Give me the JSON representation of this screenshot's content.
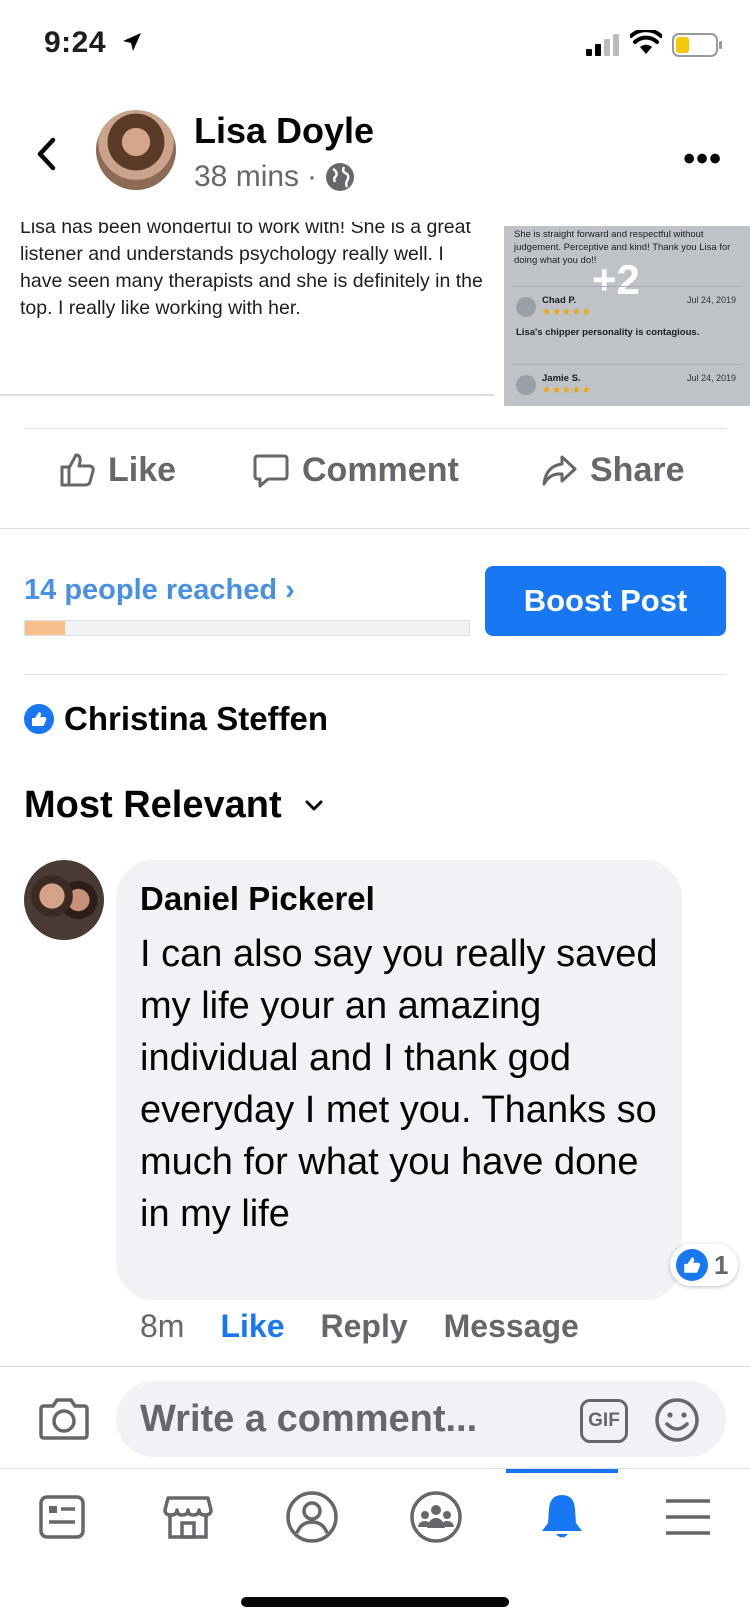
{
  "status_bar": {
    "time": "9:24"
  },
  "post": {
    "author": "Lisa Doyle",
    "time": "38 mins",
    "separator": "·",
    "text": "Lisa has been wonderful to work with! She is a great listener and understands psychology really well. I have seen many therapists and she is definitely in the top. I really like working with her.",
    "review_image": {
      "top_text": "She is straight forward and respectful without judgement.  Perceptive and kind! Thank you Lisa for doing what you do!!",
      "more_count": "+2",
      "entries": [
        {
          "name": "Chad P.",
          "date": "Jul 24, 2019",
          "stars": "★★★★★",
          "text": "Lisa's chipper personality is contagious."
        },
        {
          "name": "Jamie S.",
          "date": "Jul 24, 2019",
          "stars": "★★★★★",
          "text": ""
        }
      ]
    }
  },
  "actions": {
    "like": "Like",
    "comment": "Comment",
    "share": "Share"
  },
  "reach": {
    "label": "14 people reached",
    "chevron": "›",
    "progress_percent": 9,
    "boost_label": "Boost Post"
  },
  "liker": {
    "name": "Christina Steffen"
  },
  "sort": {
    "label": "Most Relevant"
  },
  "comment": {
    "author": "Daniel Pickerel",
    "text": "I can also say you really saved my life your an amazing individual and I thank god everyday I met you. Thanks so much for what you have done in my life",
    "reaction_count": "1",
    "time": "8m",
    "like": "Like",
    "reply": "Reply",
    "message": "Message"
  },
  "composer": {
    "placeholder": "Write a comment...",
    "gif": "GIF"
  },
  "tabs": [
    {
      "name": "news-feed-icon"
    },
    {
      "name": "marketplace-icon"
    },
    {
      "name": "profile-icon"
    },
    {
      "name": "groups-icon"
    },
    {
      "name": "notifications-icon",
      "active": true
    },
    {
      "name": "menu-icon"
    }
  ],
  "colors": {
    "accent": "#1877f2",
    "reach_text": "#4a90e2",
    "reach_fill": "#f5c08c",
    "muted": "#65676b"
  }
}
